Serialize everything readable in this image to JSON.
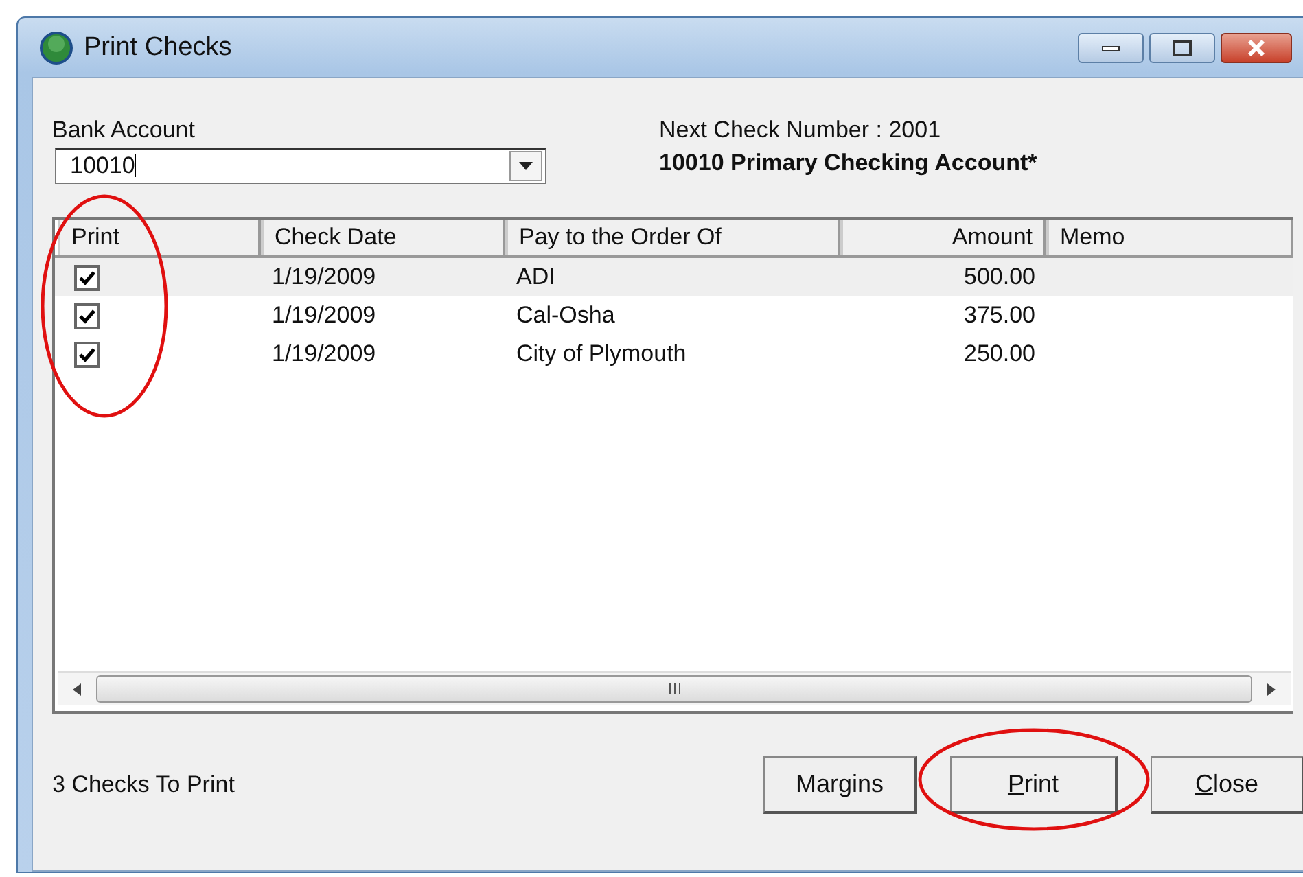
{
  "window": {
    "title": "Print Checks"
  },
  "bank_account": {
    "label": "Bank Account",
    "value": "10010"
  },
  "next_check": {
    "label": "Next Check Number : 2001",
    "account_name": "10010 Primary Checking Account*"
  },
  "table": {
    "columns": [
      {
        "label": "Print",
        "right_aligned": false,
        "highlighted": true
      },
      {
        "label": "Check Date",
        "right_aligned": false,
        "highlighted": false
      },
      {
        "label": "Pay to the Order Of",
        "right_aligned": false,
        "highlighted": false
      },
      {
        "label": "Amount",
        "right_aligned": true,
        "highlighted": false
      },
      {
        "label": "Memo",
        "right_aligned": false,
        "highlighted": false
      }
    ],
    "rows": [
      {
        "selected": true,
        "print": true,
        "date": "1/19/2009",
        "payee": "ADI",
        "amount": "500.00"
      },
      {
        "selected": false,
        "print": true,
        "date": "1/19/2009",
        "payee": "Cal-Osha",
        "amount": "375.00"
      },
      {
        "selected": false,
        "print": true,
        "date": "1/19/2009",
        "payee": "City of Plymouth",
        "amount": "250.00"
      }
    ]
  },
  "status": "3 Checks To Print",
  "buttons": [
    {
      "label": "Margins",
      "mnemonic": false,
      "highlighted": false
    },
    {
      "label": "Print",
      "mnemonic": true,
      "highlighted": true
    },
    {
      "label": "Close",
      "mnemonic": true,
      "highlighted": false
    }
  ]
}
